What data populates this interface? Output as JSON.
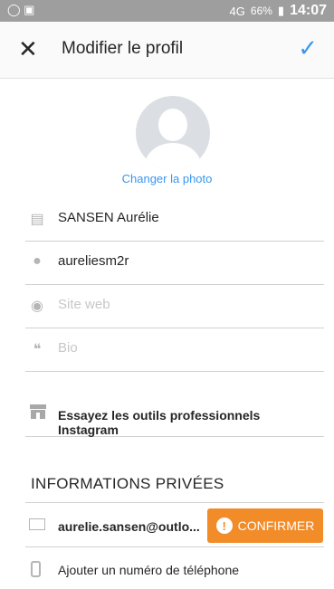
{
  "status_bar": {
    "left_icons": "◯ ▣",
    "network": "4G",
    "battery_pct": "66%",
    "time": "14:07"
  },
  "app_bar": {
    "close_icon": "close-icon",
    "title": "Modifier le profil",
    "confirm_icon": "check-icon"
  },
  "profile": {
    "change_photo": "Changer la photo"
  },
  "fields": {
    "name": "SANSEN Aurélie",
    "username": "aureliesm2r",
    "website_placeholder": "Site web",
    "bio_placeholder": "Bio"
  },
  "business": {
    "label": "Essayez les outils professionnels Instagram"
  },
  "private_info": {
    "title": "INFORMATIONS PRIVÉES",
    "email": "aurelie.sansen@outlo...",
    "confirm_button": "CONFIRMER",
    "phone_placeholder": "Ajouter un numéro de téléphone"
  },
  "colors": {
    "accent": "#3897f0",
    "confirm": "#f28c28"
  }
}
